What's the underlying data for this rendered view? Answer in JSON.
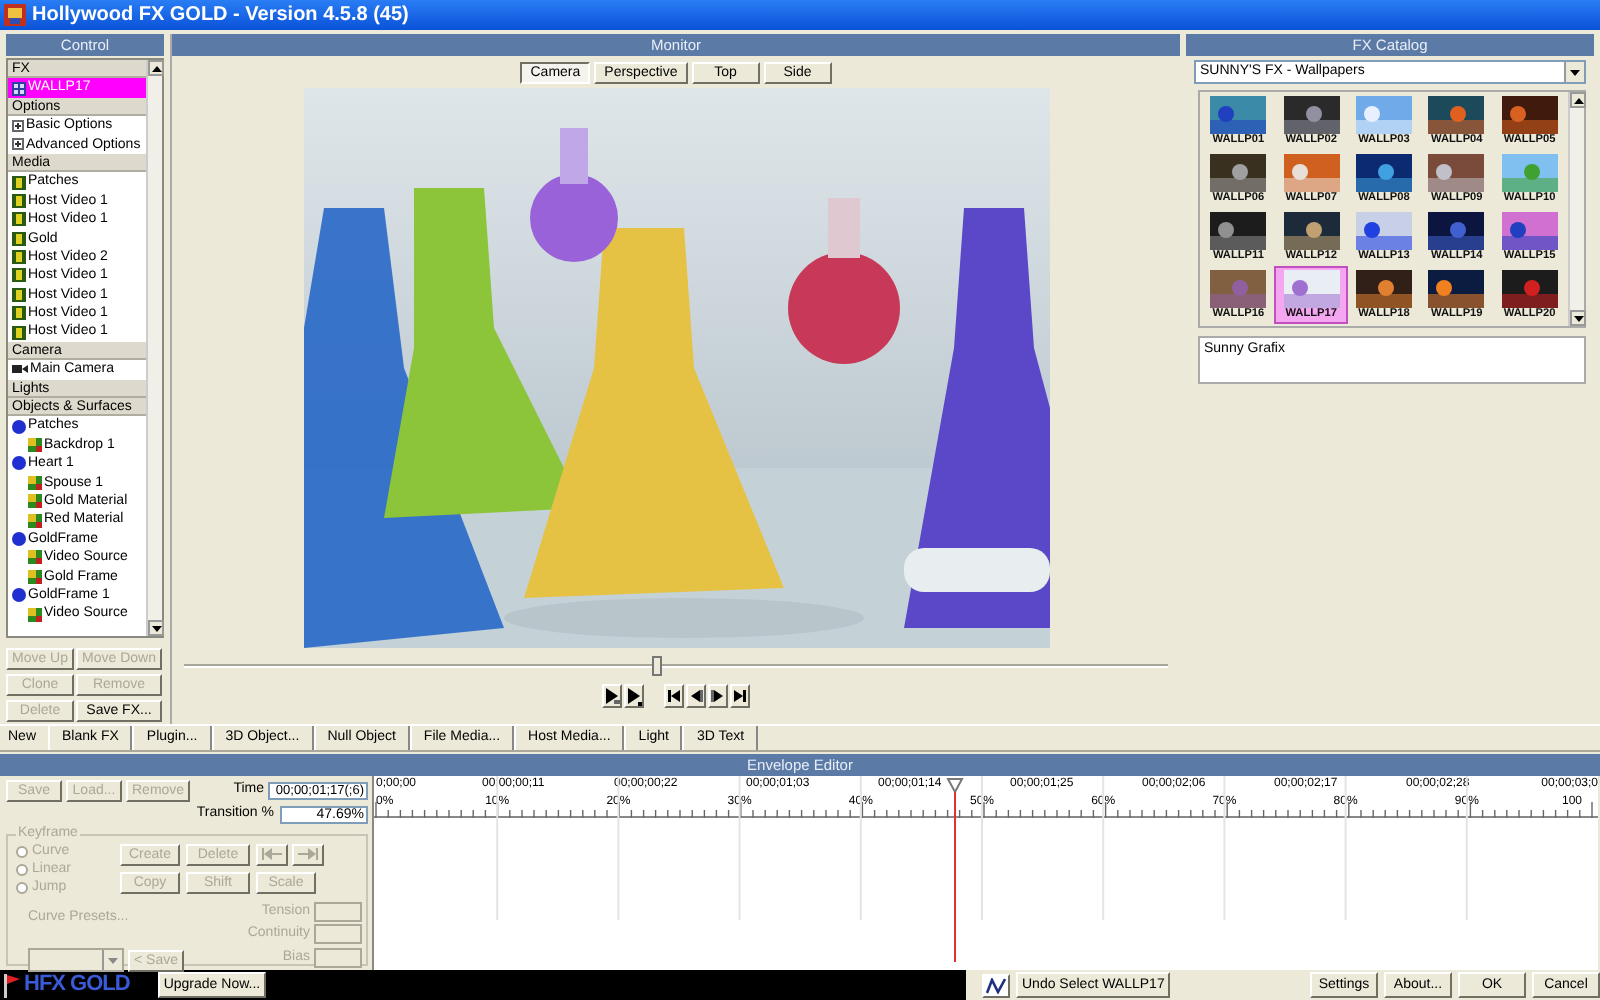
{
  "window": {
    "title": "Hollywood FX GOLD - Version 4.5.8 (45)"
  },
  "control": {
    "title": "Control",
    "items": [
      {
        "kind": "section",
        "label": "FX"
      },
      {
        "kind": "fx",
        "label": "WALLP17",
        "selected": true
      },
      {
        "kind": "section",
        "label": "Options"
      },
      {
        "kind": "option",
        "label": "Basic Options",
        "selected": false
      },
      {
        "kind": "option",
        "label": "Advanced Options",
        "selected": false
      },
      {
        "kind": "section",
        "label": "Media"
      },
      {
        "kind": "media",
        "label": "Patches",
        "selected": false
      },
      {
        "kind": "media",
        "label": "Host Video 1",
        "selected": false
      },
      {
        "kind": "media",
        "label": "Host Video 1",
        "selected": false
      },
      {
        "kind": "media",
        "label": "Gold",
        "selected": false
      },
      {
        "kind": "media",
        "label": "Host Video 2",
        "selected": false
      },
      {
        "kind": "media",
        "label": "Host Video 1",
        "selected": false
      },
      {
        "kind": "media",
        "label": "Host Video 1",
        "selected": false
      },
      {
        "kind": "media",
        "label": "Host Video 1",
        "selected": false
      },
      {
        "kind": "media",
        "label": "Host Video 1",
        "selected": false
      },
      {
        "kind": "section",
        "label": "Camera"
      },
      {
        "kind": "camera",
        "label": "Main Camera",
        "selected": false
      },
      {
        "kind": "section",
        "label": "Lights"
      },
      {
        "kind": "section",
        "label": "Objects & Surfaces"
      },
      {
        "kind": "object",
        "label": "Patches",
        "selected": false,
        "children": [
          {
            "label": "Backdrop 1",
            "selected": false
          }
        ]
      },
      {
        "kind": "object",
        "label": "Heart 1",
        "selected": false,
        "children": [
          {
            "label": "Spouse 1",
            "selected": false
          },
          {
            "label": "Gold Material",
            "selected": false
          },
          {
            "label": "Red Material",
            "selected": false
          }
        ]
      },
      {
        "kind": "object",
        "label": "GoldFrame",
        "selected": false,
        "children": [
          {
            "label": "Video Source",
            "selected": false
          },
          {
            "label": "Gold Frame",
            "selected": false
          }
        ]
      },
      {
        "kind": "object",
        "label": "GoldFrame 1",
        "selected": false,
        "children": [
          {
            "label": "Video Source",
            "selected": false
          }
        ]
      }
    ],
    "buttons": [
      {
        "label": "Move Up",
        "disabled": true
      },
      {
        "label": "Move Down",
        "disabled": true
      },
      {
        "label": "Clone",
        "disabled": true
      },
      {
        "label": "Remove",
        "disabled": true
      },
      {
        "label": "Delete",
        "disabled": true
      },
      {
        "label": "Save FX...",
        "disabled": false
      }
    ]
  },
  "monitor": {
    "title": "Monitor",
    "tabs": [
      {
        "label": "Camera",
        "selected": true
      },
      {
        "label": "Perspective",
        "selected": false
      },
      {
        "label": "Top",
        "selected": false
      },
      {
        "label": "Side",
        "selected": false
      }
    ],
    "scrubber": {
      "level": 0.48
    }
  },
  "catalog": {
    "title": "FX Catalog",
    "collection": "SUNNY'S FX - Wallpapers",
    "thumbnails": [
      {
        "label": "WALLP01",
        "selected": false
      },
      {
        "label": "WALLP02",
        "selected": false
      },
      {
        "label": "WALLP03",
        "selected": false
      },
      {
        "label": "WALLP04",
        "selected": false
      },
      {
        "label": "WALLP05",
        "selected": false
      },
      {
        "label": "WALLP06",
        "selected": false
      },
      {
        "label": "WALLP07",
        "selected": false
      },
      {
        "label": "WALLP08",
        "selected": false
      },
      {
        "label": "WALLP09",
        "selected": false
      },
      {
        "label": "WALLP10",
        "selected": false
      },
      {
        "label": "WALLP11",
        "selected": false
      },
      {
        "label": "WALLP12",
        "selected": false
      },
      {
        "label": "WALLP13",
        "selected": false
      },
      {
        "label": "WALLP14",
        "selected": false
      },
      {
        "label": "WALLP15",
        "selected": false
      },
      {
        "label": "WALLP16",
        "selected": false
      },
      {
        "label": "WALLP17",
        "selected": true
      },
      {
        "label": "WALLP18",
        "selected": false
      },
      {
        "label": "WALLP19",
        "selected": false
      },
      {
        "label": "WALLP20",
        "selected": false
      }
    ],
    "author": "Sunny Grafix"
  },
  "toolbar": {
    "label": "New",
    "buttons": [
      "Blank FX",
      "Plugin...",
      "3D Object...",
      "Null Object",
      "File Media...",
      "Host Media...",
      "Light",
      "3D Text"
    ]
  },
  "envelope": {
    "title": "Envelope Editor",
    "buttons": [
      {
        "label": "Save",
        "disabled": true
      },
      {
        "label": "Load...",
        "disabled": true
      },
      {
        "label": "Remove",
        "disabled": true
      }
    ],
    "time_label": "Time",
    "time": "00;00;01;17(;6)",
    "transition_label": "Transition %",
    "transition": "47.69%",
    "keyframe": {
      "title": "Keyframe",
      "modes": [
        {
          "label": "Curve",
          "selected": false,
          "disabled": true
        },
        {
          "label": "Linear",
          "selected": false,
          "disabled": true
        },
        {
          "label": "Jump",
          "selected": false,
          "disabled": true
        }
      ],
      "buttons": [
        {
          "label": "Create",
          "disabled": true
        },
        {
          "label": "Delete",
          "disabled": true
        },
        {
          "label": "Copy",
          "disabled": true
        },
        {
          "label": "Shift",
          "disabled": true
        },
        {
          "label": "Scale",
          "disabled": true
        }
      ],
      "fields": [
        {
          "label": "Tension",
          "disabled": true
        },
        {
          "label": "Continuity",
          "disabled": true
        },
        {
          "label": "Bias",
          "disabled": true
        }
      ],
      "presets_label": "Curve Presets...",
      "save_button": "< Save"
    },
    "ruler": {
      "times": [
        "0;00;00",
        "00;00;00;11",
        "00;00;00;22",
        "00;00;01;03",
        "00;00;01;14",
        "00;00;01;25",
        "00;00;02;06",
        "00;00;02;17",
        "00;00;02;28",
        "00;00;03;0"
      ],
      "percents": [
        "0%",
        "10%",
        "20%",
        "30%",
        "40%",
        "50%",
        "60%",
        "70%",
        "80%",
        "90%",
        "100"
      ]
    },
    "playhead": {
      "level": 0.4769
    }
  },
  "bottom": {
    "logo": "HFX GOLD",
    "upgrade": "Upgrade Now...",
    "undo": "Undo Select WALLP17",
    "buttons": [
      "Settings",
      "About...",
      "OK",
      "Cancel"
    ]
  }
}
